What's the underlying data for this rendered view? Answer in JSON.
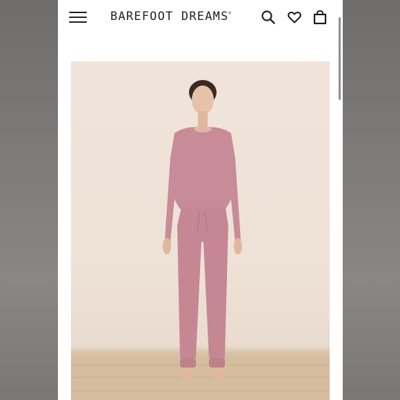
{
  "header": {
    "brand": "BAREFOOT DREAMS",
    "brand_mark": "®",
    "icons": [
      "menu-icon",
      "search-icon",
      "heart-icon",
      "shopping-bag-icon"
    ]
  },
  "product": {
    "image": "model-in-pink-lounge-set"
  },
  "colors": {
    "background": "#ffffff",
    "text": "#1d1d1d",
    "garment": "#c98c9a",
    "backdrop": "#efe3d8",
    "floor": "#d5bc9e"
  }
}
